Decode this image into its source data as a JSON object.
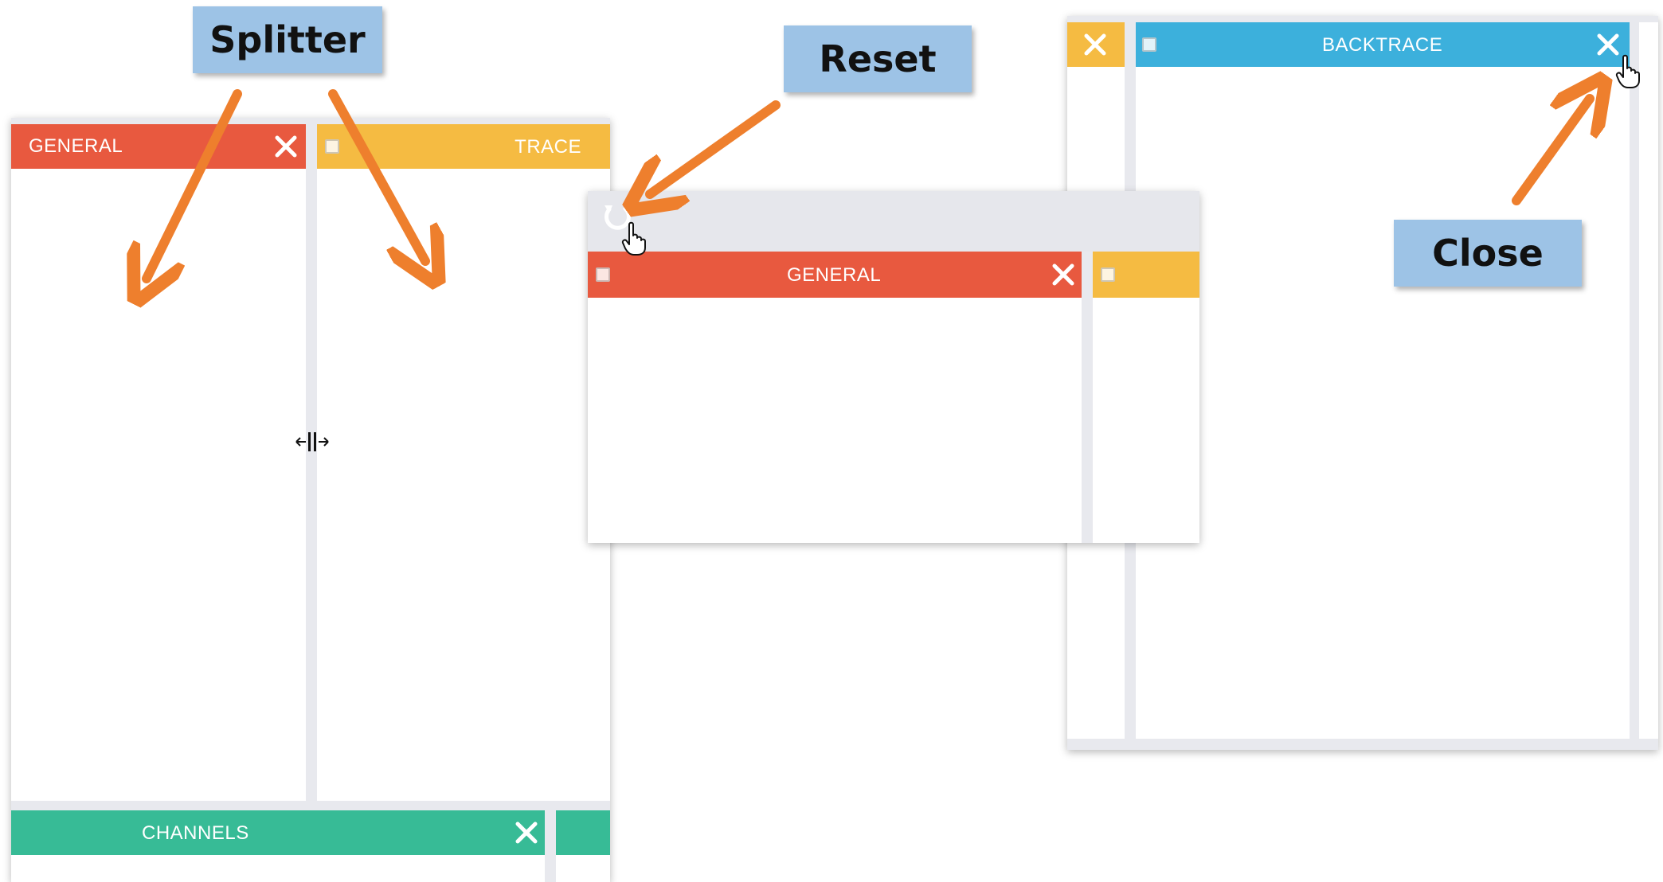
{
  "callouts": {
    "splitter": "Splitter",
    "reset": "Reset",
    "close": "Close"
  },
  "left_window": {
    "general_tab": "GENERAL",
    "trace_tab": "TRACE",
    "channels_tab": "CHANNELS"
  },
  "middle_window": {
    "general_tab": "GENERAL",
    "reset_icon": "refresh-icon"
  },
  "right_window": {
    "backtrace_tab": "BACKTRACE"
  },
  "colors": {
    "general": "#e8593f",
    "trace": "#f5bb42",
    "channels": "#37bb96",
    "backtrace": "#3cb0dc",
    "arrow": "#ee7f2d",
    "callout": "#9dc3e6"
  }
}
